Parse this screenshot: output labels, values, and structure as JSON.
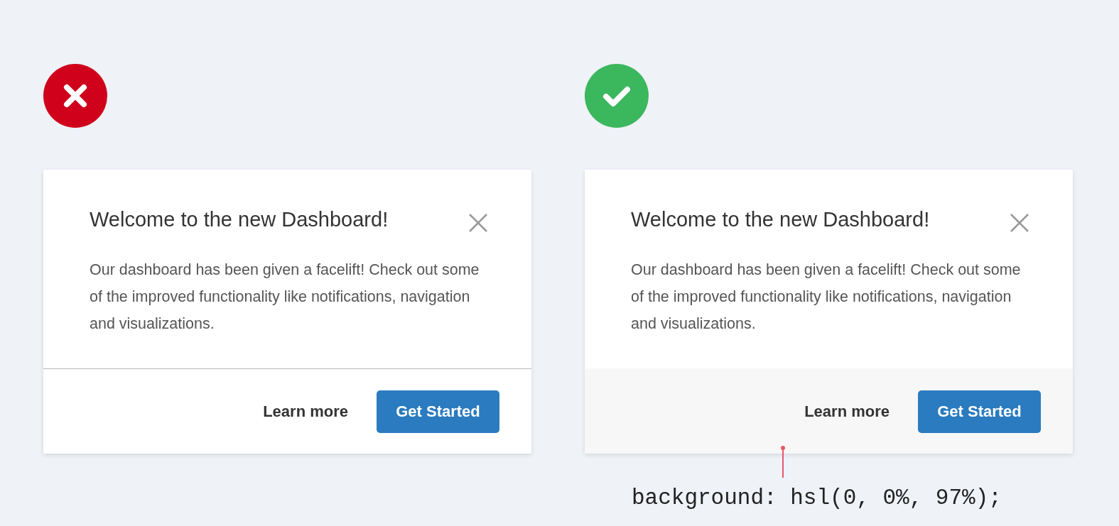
{
  "panels": [
    {
      "approved": false,
      "dialog": {
        "title": "Welcome to the new Dashboard!",
        "body": "Our dashboard has been given a facelift! Check out some of the improved functionality like notifications, navigation and visualizations.",
        "footer_shaded": false,
        "secondary_button": "Learn more",
        "primary_button": "Get Started"
      }
    },
    {
      "approved": true,
      "dialog": {
        "title": "Welcome to the new Dashboard!",
        "body": "Our dashboard has been given a facelift! Check out some of the improved functionality like notifications, navigation and visualizations.",
        "footer_shaded": true,
        "secondary_button": "Learn more",
        "primary_button": "Get Started"
      },
      "annotation": "background: hsl(0, 0%, 97%);"
    }
  ]
}
